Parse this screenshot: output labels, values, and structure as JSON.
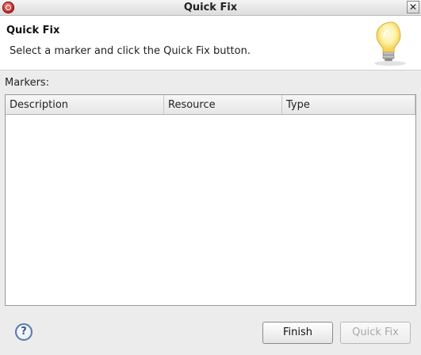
{
  "window": {
    "title": "Quick Fix",
    "close_label": "✕",
    "app_icon": "eclipse-icon"
  },
  "header": {
    "title": "Quick Fix",
    "description": "Select a marker and click the Quick Fix button.",
    "icon": "lightbulb-icon"
  },
  "markers": {
    "label": "Markers:",
    "columns": [
      "Description",
      "Resource",
      "Type"
    ],
    "rows": []
  },
  "footer": {
    "help_icon": "help-icon",
    "help_label": "?",
    "finish_label": "Finish",
    "quickfix_label": "Quick Fix",
    "quickfix_enabled": false
  },
  "colors": {
    "disabled_text": "#a8a8a8",
    "help_accent": "#5a7aa8"
  }
}
